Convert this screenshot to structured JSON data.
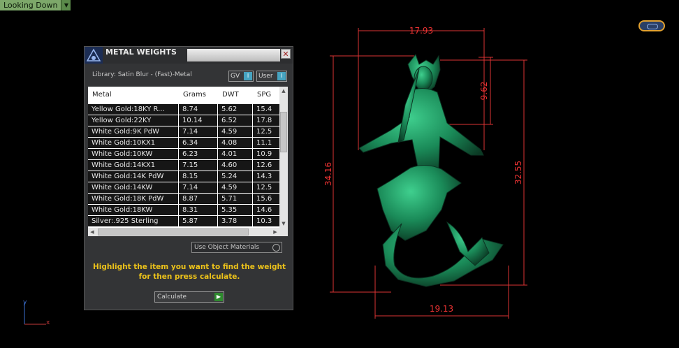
{
  "viewport": {
    "view_label": "Looking Down"
  },
  "panel": {
    "title": "METAL WEIGHTS",
    "library": "Library: Satin Blur - (Fast)-Metal",
    "toggle_gv": "GV",
    "toggle_user": "User",
    "columns": [
      "Metal",
      "Grams",
      "DWT",
      "SPG"
    ],
    "rows": [
      [
        "Yellow Gold:18KY R...",
        "8.74",
        "5.62",
        "15.4"
      ],
      [
        "Yellow Gold:22KY",
        "10.14",
        "6.52",
        "17.8"
      ],
      [
        "White Gold:9K PdW",
        "7.14",
        "4.59",
        "12.5"
      ],
      [
        "White Gold:10KX1",
        "6.34",
        "4.08",
        "11.1"
      ],
      [
        "White Gold:10KW",
        "6.23",
        "4.01",
        "10.9"
      ],
      [
        "White Gold:14KX1",
        "7.15",
        "4.60",
        "12.6"
      ],
      [
        "White Gold:14K PdW",
        "8.15",
        "5.24",
        "14.3"
      ],
      [
        "White Gold:14KW",
        "7.14",
        "4.59",
        "12.5"
      ],
      [
        "White Gold:18K PdW",
        "8.87",
        "5.71",
        "15.6"
      ],
      [
        "White Gold:18KW",
        "8.31",
        "5.35",
        "14.6"
      ],
      [
        "Silver:.925 Sterling",
        "5.87",
        "3.78",
        "10.3"
      ]
    ],
    "use_object_materials": "Use Object Materials",
    "instructions_line1": "Highlight the item you want to find the weight",
    "instructions_line2": "for then press calculate.",
    "calculate_label": "Calculate"
  },
  "dimensions": {
    "top": "17.93",
    "upper_right": "9.62",
    "left": "34.16",
    "right": "32.55",
    "bottom": "19.13"
  },
  "axes": {
    "y": "y",
    "x": "x"
  },
  "colors": {
    "dimension": "#e33333",
    "model": "#1f8a5a",
    "instruction": "#ecc21a"
  }
}
